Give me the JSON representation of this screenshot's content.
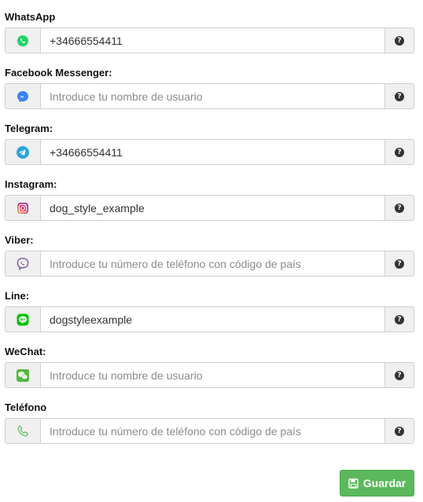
{
  "fields": [
    {
      "label": "WhatsApp",
      "value": "+34666554411",
      "placeholder": "",
      "icon": "whatsapp-icon"
    },
    {
      "label": "Facebook Messenger:",
      "value": "",
      "placeholder": "Introduce tu nombre de usuario",
      "icon": "messenger-icon"
    },
    {
      "label": "Telegram:",
      "value": "+34666554411",
      "placeholder": "",
      "icon": "telegram-icon"
    },
    {
      "label": "Instagram:",
      "value": "dog_style_example",
      "placeholder": "",
      "icon": "instagram-icon"
    },
    {
      "label": "Viber:",
      "value": "",
      "placeholder": "Introduce tu número de teléfono con código de país",
      "icon": "viber-icon"
    },
    {
      "label": "Line:",
      "value": "dogstyleexample",
      "placeholder": "",
      "icon": "line-icon"
    },
    {
      "label": "WeChat:",
      "value": "",
      "placeholder": "Introduce tu nombre de usuario",
      "icon": "wechat-icon"
    },
    {
      "label": "Teléfono",
      "value": "",
      "placeholder": "Introduce tu número de teléfono con código de país",
      "icon": "phone-icon"
    }
  ],
  "help_glyph": "?",
  "save_button": {
    "label": "Guardar",
    "icon": "floppy-disk-icon",
    "color": "#5cb85c"
  },
  "colors": {
    "whatsapp": "#25d366",
    "messenger": "#3b82f6",
    "telegram": "#2aa3df",
    "instagram": "#d6249f",
    "viber": "#7d51a0",
    "line": "#00c300",
    "wechat": "#51b83c",
    "phone": "#6abf69"
  }
}
